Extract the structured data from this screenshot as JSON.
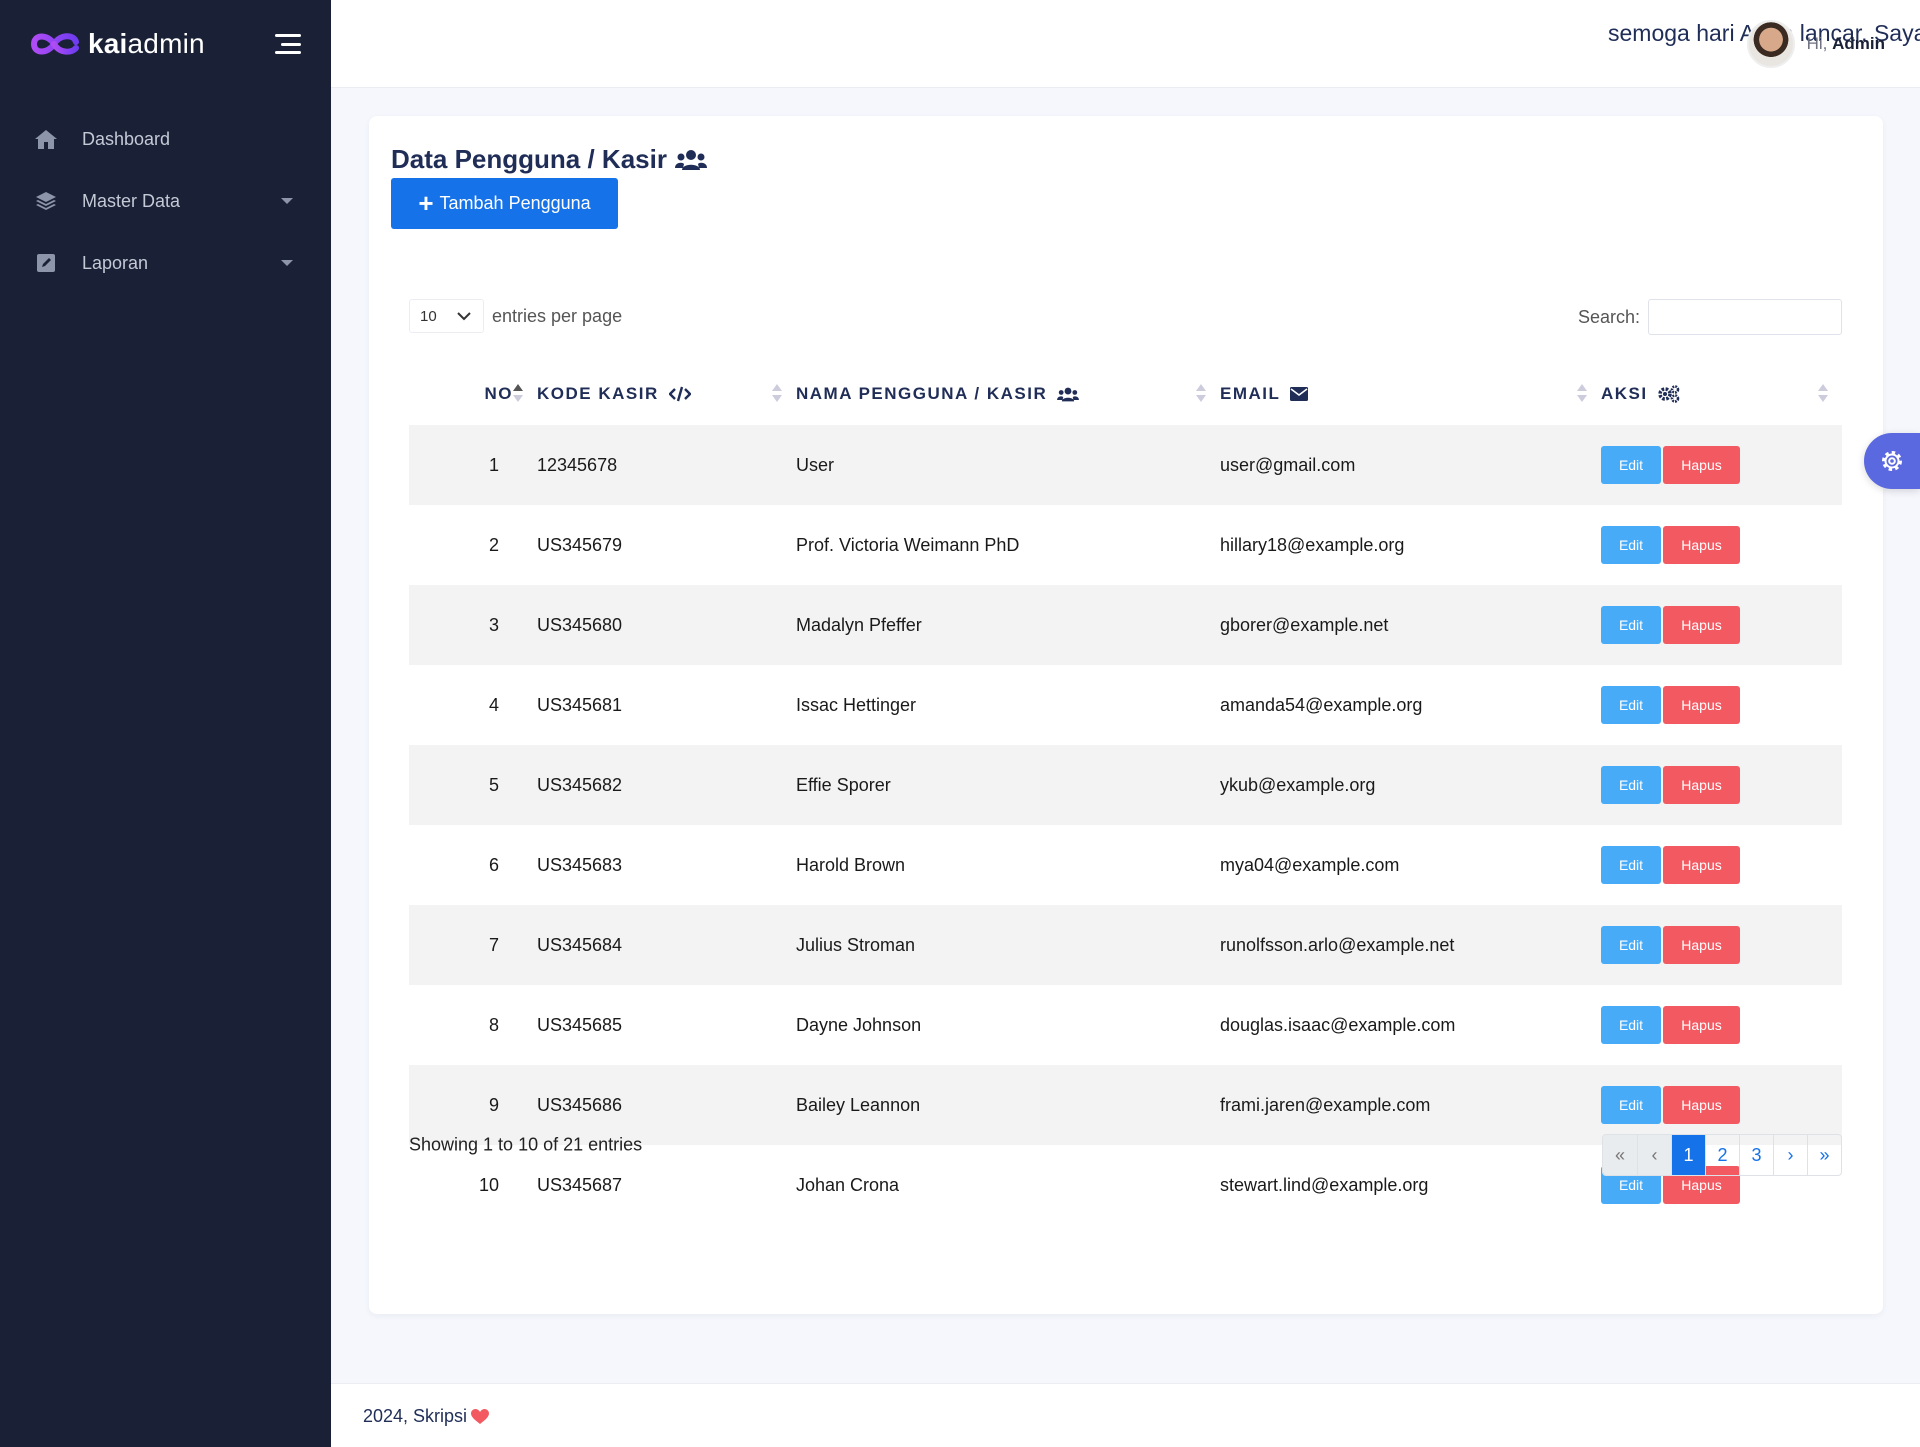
{
  "brand": {
    "name_bold": "kai",
    "name_rest": "admin",
    "accent": "#8a3ffc"
  },
  "header": {
    "marquee": "semoga hari Anda lancar. Saya i",
    "greeting": "Hi,",
    "user_name": "Admin"
  },
  "sidebar": {
    "items": [
      {
        "label": "Dashboard",
        "icon": "home-icon"
      },
      {
        "label": "Master Data",
        "icon": "layers-icon"
      },
      {
        "label": "Laporan",
        "icon": "edit-icon"
      }
    ]
  },
  "page": {
    "title": "Data Pengguna / Kasir",
    "add_button": "Tambah Pengguna"
  },
  "table_controls": {
    "entries_value": "10",
    "entries_label": "entries per page",
    "search_label": "Search:"
  },
  "table": {
    "columns": [
      "NO",
      "KODE KASIR",
      "NAMA PENGGUNA / KASIR",
      "EMAIL",
      "AKSI"
    ],
    "rows": [
      {
        "no": "1",
        "kode": "12345678",
        "nama": "User",
        "email": "user@gmail.com"
      },
      {
        "no": "2",
        "kode": "US345679",
        "nama": "Prof. Victoria Weimann PhD",
        "email": "hillary18@example.org"
      },
      {
        "no": "3",
        "kode": "US345680",
        "nama": "Madalyn Pfeffer",
        "email": "gborer@example.net"
      },
      {
        "no": "4",
        "kode": "US345681",
        "nama": "Issac Hettinger",
        "email": "amanda54@example.org"
      },
      {
        "no": "5",
        "kode": "US345682",
        "nama": "Effie Sporer",
        "email": "ykub@example.org"
      },
      {
        "no": "6",
        "kode": "US345683",
        "nama": "Harold Brown",
        "email": "mya04@example.com"
      },
      {
        "no": "7",
        "kode": "US345684",
        "nama": "Julius Stroman",
        "email": "runolfsson.arlo@example.net"
      },
      {
        "no": "8",
        "kode": "US345685",
        "nama": "Dayne Johnson",
        "email": "douglas.isaac@example.com"
      },
      {
        "no": "9",
        "kode": "US345686",
        "nama": "Bailey Leannon",
        "email": "frami.jaren@example.com"
      },
      {
        "no": "10",
        "kode": "US345687",
        "nama": "Johan Crona",
        "email": "stewart.lind@example.org"
      }
    ],
    "edit_label": "Edit",
    "delete_label": "Hapus"
  },
  "pagination": {
    "info": "Showing 1 to 10 of 21 entries",
    "first": "«",
    "prev": "‹",
    "pages": [
      "1",
      "2",
      "3"
    ],
    "active_page": "1",
    "next": "›",
    "last": "»"
  },
  "footer": {
    "text": "2024, Skripsi"
  }
}
